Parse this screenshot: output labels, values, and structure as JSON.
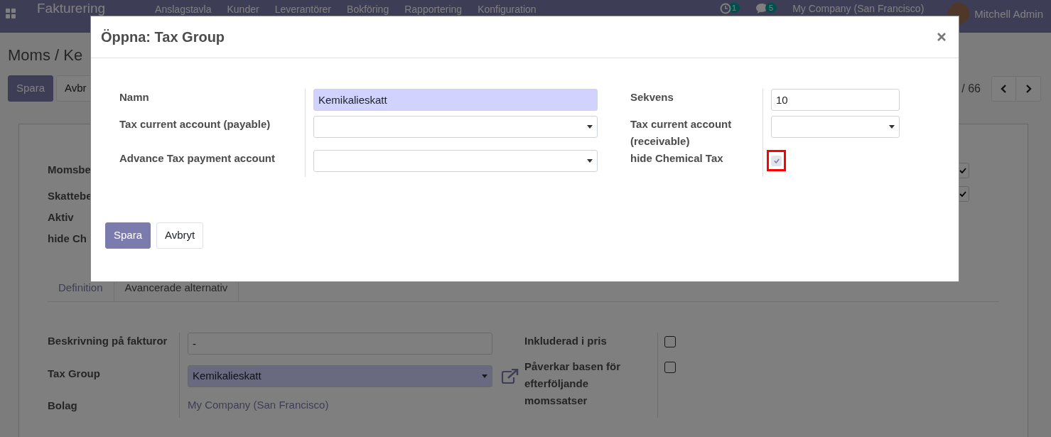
{
  "navbar": {
    "app_title": "Fakturering",
    "menu": [
      "Anslagstavla",
      "Kunder",
      "Leverantörer",
      "Bokföring",
      "Rapportering",
      "Konfiguration"
    ],
    "activity_badge": "1",
    "message_badge": "5",
    "company": "My Company (San Francisco)",
    "user": "Mitchell Admin"
  },
  "control_panel": {
    "breadcrumb": "Moms / Ke",
    "buttons": [
      {
        "label": "Spara",
        "kind": "primary"
      },
      {
        "label": "Avbr",
        "kind": "secondary"
      }
    ],
    "pager": "/ 66"
  },
  "form": {
    "header_fields": [
      "Momsbe",
      "Skattebe",
      "Aktiv",
      "hide Ch"
    ],
    "side_checks": [
      {
        "checked": true
      },
      {
        "checked": true
      }
    ],
    "tabs": [
      {
        "label": "Definition",
        "selected": false
      },
      {
        "label": "Avancerade alternativ",
        "selected": true
      }
    ],
    "left_fields": [
      {
        "label": "Beskrivning på fakturor",
        "kind": "text",
        "value": "-",
        "required": false
      },
      {
        "label": "Tax Group",
        "kind": "select",
        "value": "Kemikalieskatt",
        "required": true
      },
      {
        "label": "Bolag",
        "kind": "link",
        "value": "My Company (San Francisco)"
      }
    ],
    "right_fields": [
      {
        "label": "Inkluderad i pris",
        "checked": false
      },
      {
        "label": "Påverkar basen för efterföljande momssatser",
        "checked": false
      }
    ]
  },
  "dialog": {
    "title": "Öppna: Tax Group",
    "rows": [
      {
        "left": {
          "label": "Namn",
          "kind": "text",
          "value": "Kemikalieskatt",
          "required": true
        },
        "right": {
          "label": "Sekvens",
          "kind": "text",
          "value": "10",
          "required": false
        }
      },
      {
        "left": {
          "label": "Tax current account (payable)",
          "kind": "select",
          "required": false
        },
        "right": {
          "label": "Tax current account (receivable)",
          "kind": "select",
          "required": false
        }
      },
      {
        "left": {
          "label": "Advance Tax payment account",
          "kind": "select",
          "required": false
        },
        "right": {
          "label": "hide Chemical Tax",
          "kind": "checkbox",
          "checked": true,
          "highlighted": true
        }
      }
    ],
    "buttons": [
      {
        "label": "Spara",
        "kind": "primary"
      },
      {
        "label": "Avbryt",
        "kind": "secondary"
      }
    ]
  }
}
